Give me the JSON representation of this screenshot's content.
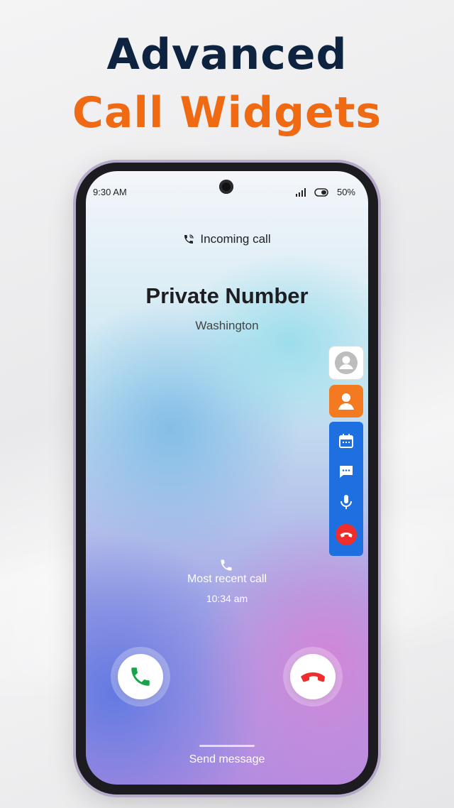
{
  "headline": {
    "line1": "Advanced",
    "line2": "Call Widgets"
  },
  "status_bar": {
    "time": "9:30 AM",
    "battery": "50%"
  },
  "call": {
    "incoming_label": "Incoming call",
    "caller_name": "Private Number",
    "location": "Washington",
    "recent_label": "Most recent call",
    "recent_time": "10:34 am",
    "send_message": "Send message"
  },
  "icons": {
    "incoming": "phone-call-icon",
    "accept": "phone-accept-icon",
    "decline": "phone-decline-icon",
    "widget": [
      "person-icon",
      "person-icon",
      "calendar-icon",
      "chat-icon",
      "microphone-icon",
      "phone-decline-icon"
    ]
  },
  "colors": {
    "headline_dark": "#0e2340",
    "headline_accent": "#f06a14",
    "accept_green": "#1aa34a",
    "decline_red": "#ef2d2d",
    "widget_blue": "#1e6fe0",
    "widget_orange": "#f47a22"
  }
}
